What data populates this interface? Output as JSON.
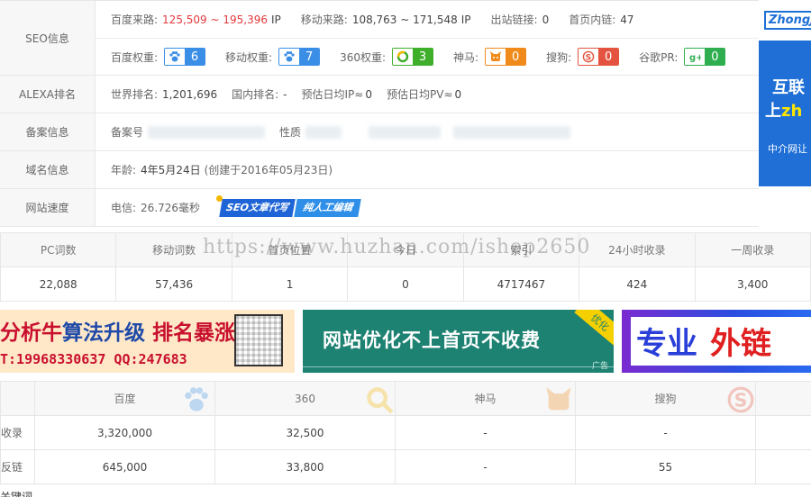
{
  "seo": {
    "label": "SEO信息",
    "baidu_traffic_label": "百度来路:",
    "baidu_traffic": "125,509 ~ 195,396",
    "baidu_traffic_unit": "IP",
    "mobile_traffic_label": "移动来路:",
    "mobile_traffic": "108,763 ~ 171,548",
    "mobile_traffic_unit": "IP",
    "outlinks_label": "出站链接:",
    "outlinks": "0",
    "home_inlinks_label": "首页内链:",
    "home_inlinks": "47",
    "weights": [
      {
        "label": "百度权重:",
        "value": "6",
        "icon": "baidu-paw-icon",
        "color": "#3a8ee6"
      },
      {
        "label": "移动权重:",
        "value": "7",
        "icon": "baidu-paw-icon",
        "color": "#3a8ee6"
      },
      {
        "label": "360权重:",
        "value": "3",
        "icon": "360-icon",
        "color": "#3fae2a"
      },
      {
        "label": "神马:",
        "value": "0",
        "icon": "shenma-icon",
        "color": "#f08a1b"
      },
      {
        "label": "搜狗:",
        "value": "0",
        "icon": "sogou-icon",
        "color": "#e4533f"
      },
      {
        "label": "谷歌PR:",
        "value": "0",
        "icon": "google-plus-icon",
        "color": "#2fae4f"
      }
    ]
  },
  "alexa": {
    "label": "ALEXA排名",
    "world_label": "世界排名:",
    "world": "1,201,696",
    "domestic_label": "国内排名:",
    "domestic": "-",
    "ip_label": "预估日均IP≈",
    "ip": "0",
    "pv_label": "预估日均PV≈",
    "pv": "0"
  },
  "icp": {
    "label": "备案信息",
    "record_label": "备案号",
    "nature_label": "性质"
  },
  "domain": {
    "label": "域名信息",
    "age_label": "年龄:",
    "age": "4年5月24日",
    "created": "(创建于2016年05月23日)"
  },
  "speed": {
    "label": "网站速度",
    "telecom_label": "电信:",
    "telecom": "26.726毫秒",
    "tag_part1": "SEO文章代写",
    "tag_part2": "纯人工编辑"
  },
  "side_ad": {
    "logo": "ZhongJ",
    "line1": "互联",
    "line2_pre": "上",
    "line2_hl": "zh",
    "line3": "中介网让"
  },
  "stats": {
    "headers": [
      "PC词数",
      "移动词数",
      "首页位置",
      "今日",
      "索引",
      "24小时收录",
      "一周收录"
    ],
    "values": [
      "22,088",
      "57,436",
      "1",
      "0",
      "4717467",
      "424",
      "3,400"
    ],
    "watermark": "https://www.huzhan.com/ishop2650"
  },
  "ads": {
    "ad1_line1_a": "分析牛",
    "ad1_line1_b": "算法升级",
    "ad1_line1_c": "排名暴涨",
    "ad1_line2": "T:19968330637  QQ:247683",
    "ad2_text": "网站优化不上首页不收费",
    "ad2_corner": "优化",
    "ad2_tag": "广告",
    "ad3_a": "专业",
    "ad3_b": "外链"
  },
  "engines": {
    "headers": [
      "",
      "百度",
      "360",
      "神马",
      "搜狗",
      ""
    ],
    "rows": [
      {
        "label": "收录",
        "values": [
          "3,320,000",
          "32,500",
          "-",
          "-",
          ""
        ]
      },
      {
        "label": "反链",
        "values": [
          "645,000",
          "33,800",
          "-",
          "55",
          ""
        ]
      }
    ]
  },
  "footer_fragment": "关键词"
}
